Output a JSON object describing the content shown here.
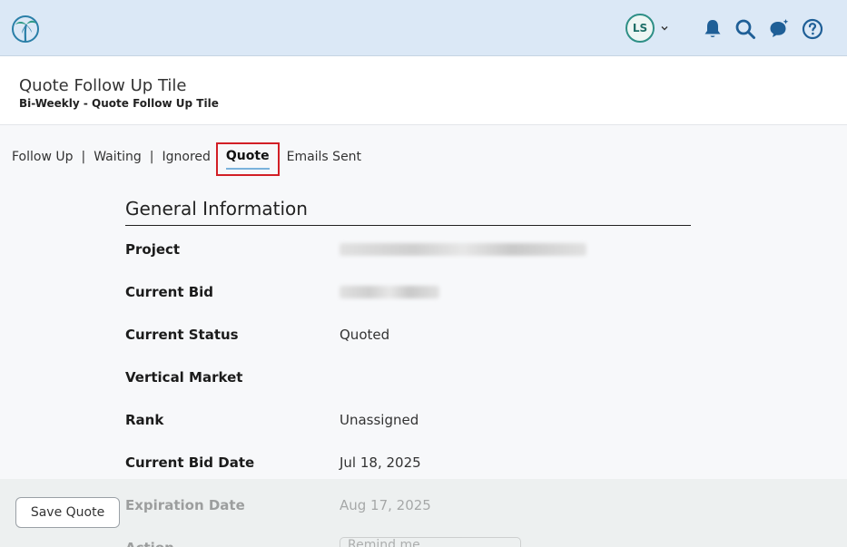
{
  "topbar": {
    "avatar_initials": "LS",
    "icons": [
      "palm-tree-logo",
      "chevron-down-icon",
      "bell-icon",
      "search-icon",
      "chat-ai-icon",
      "help-icon"
    ],
    "accent_color": "#2e8f86"
  },
  "header": {
    "title": "Quote Follow Up Tile",
    "subtitle": "Bi-Weekly - Quote Follow Up Tile"
  },
  "tabs": [
    {
      "label": "Follow Up"
    },
    {
      "label": "Waiting"
    },
    {
      "label": "Ignored"
    },
    {
      "label": "Quote",
      "active": true
    },
    {
      "label": "Emails Sent"
    }
  ],
  "section": {
    "title": "General Information",
    "rows": [
      {
        "label": "Project",
        "value": ""
      },
      {
        "label": "Current Bid",
        "value": ""
      },
      {
        "label": "Current Status",
        "value": "Quoted"
      },
      {
        "label": "Vertical Market",
        "value": ""
      },
      {
        "label": "Rank",
        "value": "Unassigned"
      },
      {
        "label": "Current Bid Date",
        "value": "Jul 18, 2025"
      },
      {
        "label": "Expiration Date",
        "value": "Aug 17, 2025"
      },
      {
        "label": "Action",
        "value": "Remind me"
      }
    ]
  },
  "footer": {
    "save_label": "Save Quote"
  }
}
